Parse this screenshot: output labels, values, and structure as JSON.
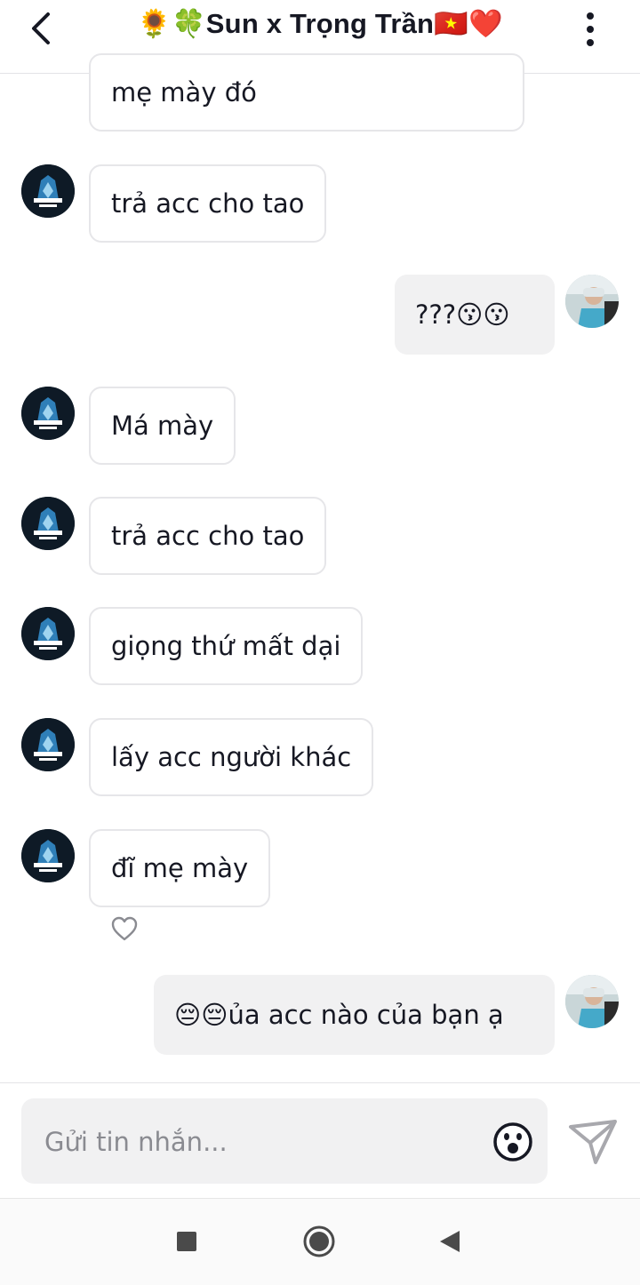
{
  "header": {
    "title": "🌻🍀Sun x Trọng Trần🇻🇳❤️"
  },
  "messages": [
    {
      "direction": "incoming",
      "text": "mẹ mày đó"
    },
    {
      "direction": "incoming",
      "text": "trả acc cho tao"
    },
    {
      "direction": "outgoing",
      "text": "???😗😗"
    },
    {
      "direction": "incoming",
      "text": "Má mày"
    },
    {
      "direction": "incoming",
      "text": "trả acc cho tao"
    },
    {
      "direction": "incoming",
      "text": "giọng thứ mất dại"
    },
    {
      "direction": "incoming",
      "text": "lấy acc người khác"
    },
    {
      "direction": "incoming",
      "text": "đĩ mẹ mày"
    },
    {
      "direction": "outgoing",
      "text": "😔😔ủa acc nào của bạn ạ"
    }
  ],
  "composer": {
    "placeholder": "Gửi tin nhắn..."
  },
  "icons": {
    "back": "chevron-left-icon",
    "more": "more-vertical-icon",
    "like": "heart-outline-icon",
    "emoji": "smiley-icon",
    "send": "send-arrow-icon",
    "nav_recents": "square-icon",
    "nav_home": "circle-icon",
    "nav_back": "triangle-back-icon"
  },
  "colors": {
    "text": "#161823",
    "incoming_border": "#e6e6e9",
    "outgoing_bg": "#f1f1f2",
    "send_icon": "#a8a8ad",
    "placeholder": "#8a8b91"
  }
}
